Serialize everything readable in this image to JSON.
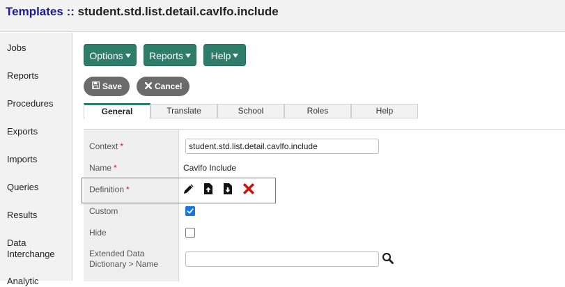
{
  "header": {
    "crumb": "Templates",
    "separator": "::",
    "title": "student.std.list.detail.cavlfo.include"
  },
  "sidebar": {
    "items": [
      {
        "label": "Jobs"
      },
      {
        "label": "Reports"
      },
      {
        "label": "Procedures"
      },
      {
        "label": "Exports"
      },
      {
        "label": "Imports"
      },
      {
        "label": "Queries"
      },
      {
        "label": "Results"
      },
      {
        "label": "Data Interchange"
      },
      {
        "label": "Analytic"
      }
    ]
  },
  "toolbar": {
    "options_label": "Options",
    "reports_label": "Reports",
    "help_label": "Help",
    "save_label": "Save",
    "cancel_label": "Cancel"
  },
  "tabs": [
    {
      "label": "General",
      "active": true
    },
    {
      "label": "Translate"
    },
    {
      "label": "School"
    },
    {
      "label": "Roles"
    },
    {
      "label": "Help"
    }
  ],
  "form": {
    "context": {
      "label": "Context",
      "required": "*",
      "value": "student.std.list.detail.cavlfo.include"
    },
    "name": {
      "label": "Name",
      "required": "*",
      "value": "Cavlfo Include"
    },
    "definition": {
      "label": "Definition",
      "required": "*",
      "icons": [
        "pencil-icon",
        "upload-icon",
        "download-icon",
        "delete-icon"
      ]
    },
    "custom": {
      "label": "Custom",
      "checked": true
    },
    "hide": {
      "label": "Hide",
      "checked": false
    },
    "extended": {
      "label": "Extended Data Dictionary > Name",
      "value": ""
    }
  },
  "colors": {
    "accent": "#2e7d6b",
    "crumb": "#1a1a9e",
    "required": "#dd1111",
    "highlight_border": "#d9534f",
    "delete": "#cc1111",
    "checkbox": "#1a73e8"
  }
}
